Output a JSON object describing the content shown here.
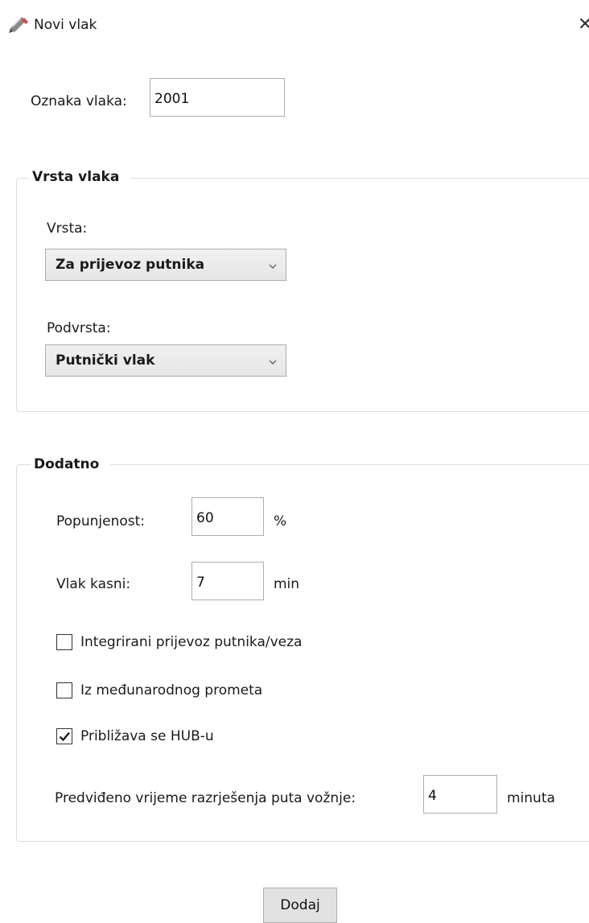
{
  "window": {
    "title": "Novi vlak",
    "close_glyph": "✕",
    "icon": "train-pencil-icon"
  },
  "train_id": {
    "label": "Oznaka vlaka:",
    "value": "2001"
  },
  "train_type_group": {
    "title": "Vrsta vlaka",
    "type_label": "Vrsta:",
    "type_value": "Za prijevoz putnika",
    "subtype_label": "Podvrsta:",
    "subtype_value": "Putnički vlak"
  },
  "extra_group": {
    "title": "Dodatno",
    "occupancy": {
      "label": "Popunjenost:",
      "value": "60",
      "unit": "%"
    },
    "delay": {
      "label": "Vlak kasni:",
      "value": "7",
      "unit": "min"
    },
    "checkboxes": [
      {
        "label": "Integrirani prijevoz putnika/veza",
        "checked": false
      },
      {
        "label": "Iz međunarodnog prometa",
        "checked": false
      },
      {
        "label": "Približava se HUB-u",
        "checked": true
      }
    ],
    "resolution": {
      "label": "Predviđeno vrijeme razrješenja puta vožnje:",
      "value": "4",
      "unit": "minuta"
    }
  },
  "actions": {
    "add_label": "Dodaj"
  }
}
